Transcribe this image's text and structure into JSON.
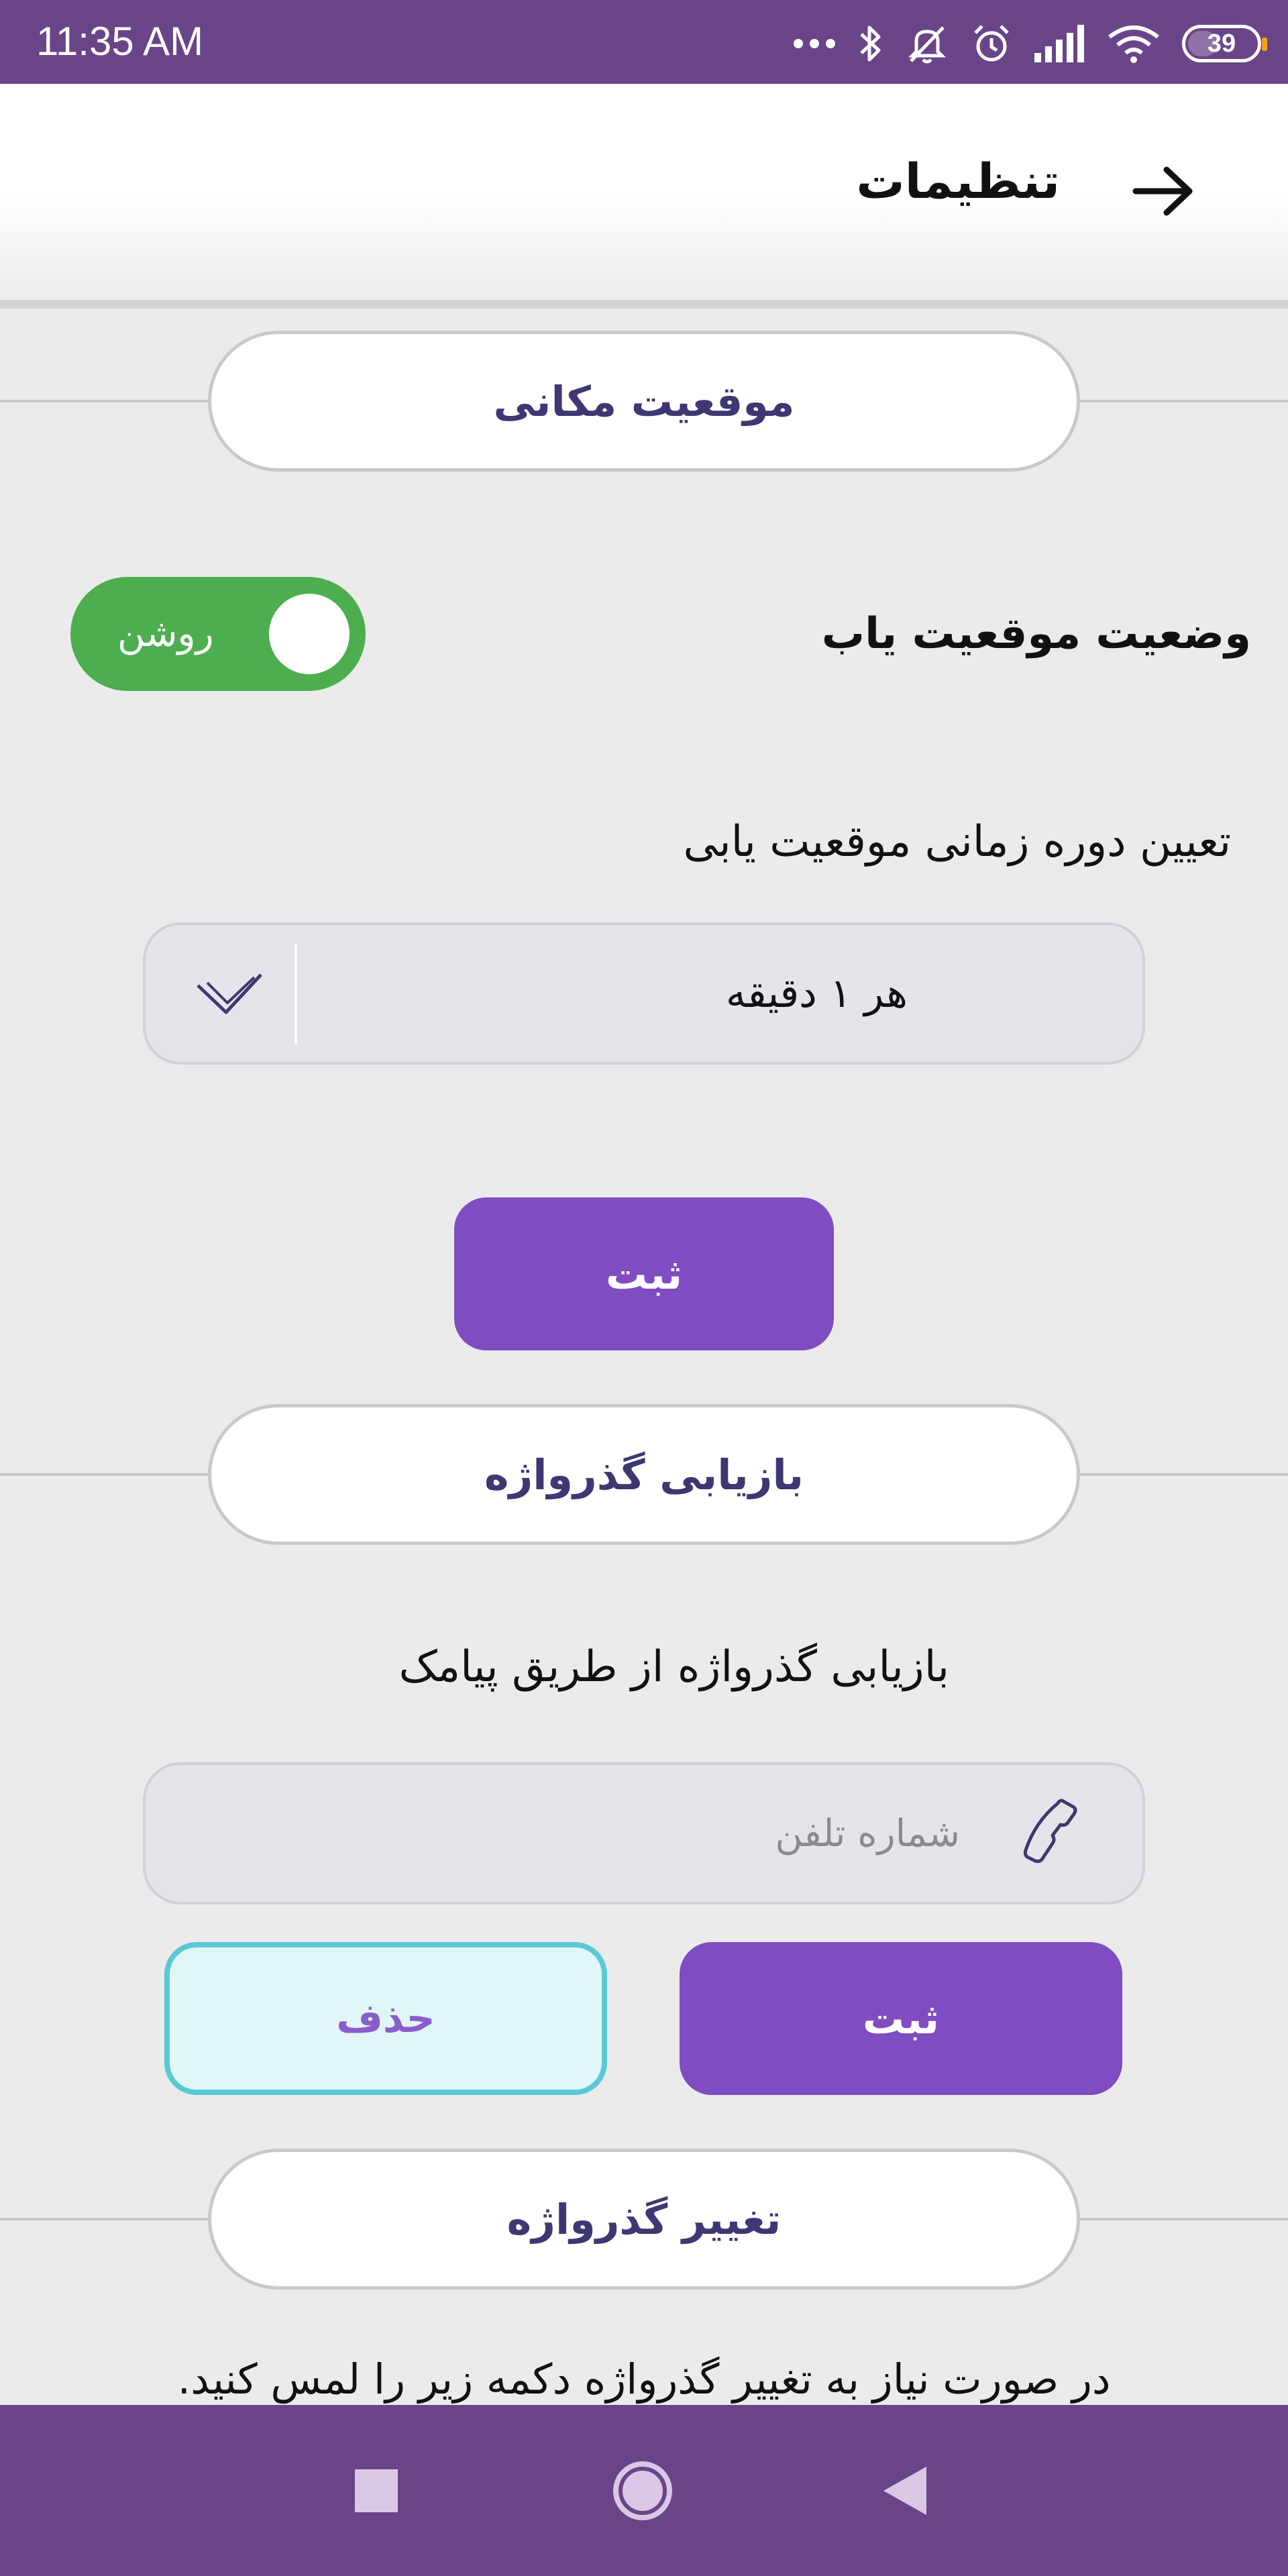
{
  "status_bar": {
    "time": "11:35 AM",
    "more": "...",
    "battery_level": "39",
    "icons": [
      "more-dots-icon",
      "bluetooth-icon",
      "mute-icon",
      "alarm-icon",
      "signal-icon",
      "wifi-icon",
      "battery-icon"
    ]
  },
  "header": {
    "title": "تنظیمات",
    "back_icon": "arrow-right-icon"
  },
  "location_section": {
    "title": "موقعیت مکانی",
    "tracker_status_label": "وضعیت موقعیت یاب",
    "toggle_label": "روشن",
    "toggle_on": true,
    "period_label": "تعیین دوره زمانی موقعیت یابی",
    "period_value": "هر ۱ دقیقه",
    "submit_label": "ثبت"
  },
  "recovery_section": {
    "title": "بازیابی گذرواژه",
    "sms_label": "بازیابی گذرواژه از طریق پیامک",
    "phone_placeholder": "شماره تلفن",
    "submit_label": "ثبت",
    "delete_label": "حذف"
  },
  "change_section": {
    "title": "تغییر گذرواژه",
    "hint": "در صورت نیاز به تغییر گذرواژه دکمه زیر را لمس کنید."
  },
  "nav_bar": {
    "icons": [
      "recents-square-icon",
      "home-circle-icon",
      "back-triangle-icon"
    ]
  },
  "colors": {
    "primary": "#804cc1",
    "status_bar": "#6a4489",
    "toggle_on": "#4cae4f",
    "section_title": "#3d3872",
    "delete_border": "#5ac9d6"
  }
}
